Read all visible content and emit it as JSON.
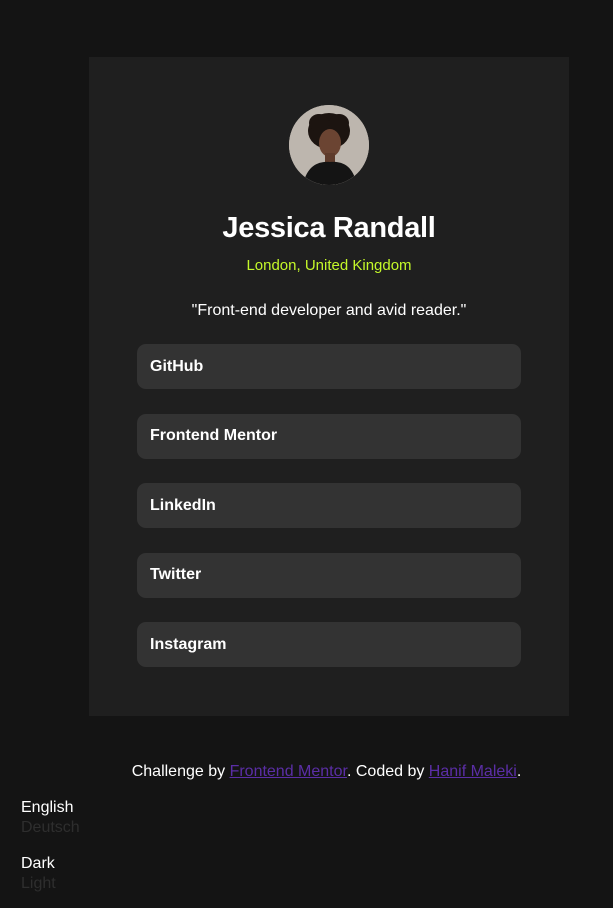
{
  "profile": {
    "name": "Jessica Randall",
    "location": "London, United Kingdom",
    "bio": "\"Front-end developer and avid reader.\""
  },
  "links": [
    {
      "label": "GitHub"
    },
    {
      "label": "Frontend Mentor"
    },
    {
      "label": "LinkedIn"
    },
    {
      "label": "Twitter"
    },
    {
      "label": "Instagram"
    }
  ],
  "footer": {
    "prefix": "Challenge by ",
    "challenge_link": "Frontend Mentor",
    "middle": ". Coded by ",
    "author_link": "Hanif Maleki",
    "suffix": "."
  },
  "language_switcher": {
    "active": "English",
    "inactive": "Deutsch"
  },
  "theme_switcher": {
    "active": "Dark",
    "inactive": "Light"
  },
  "colors": {
    "background": "#141414",
    "card": "#1f1f1f",
    "button": "#333333",
    "accent": "#c4f82a",
    "link": "#5b2ea6"
  }
}
